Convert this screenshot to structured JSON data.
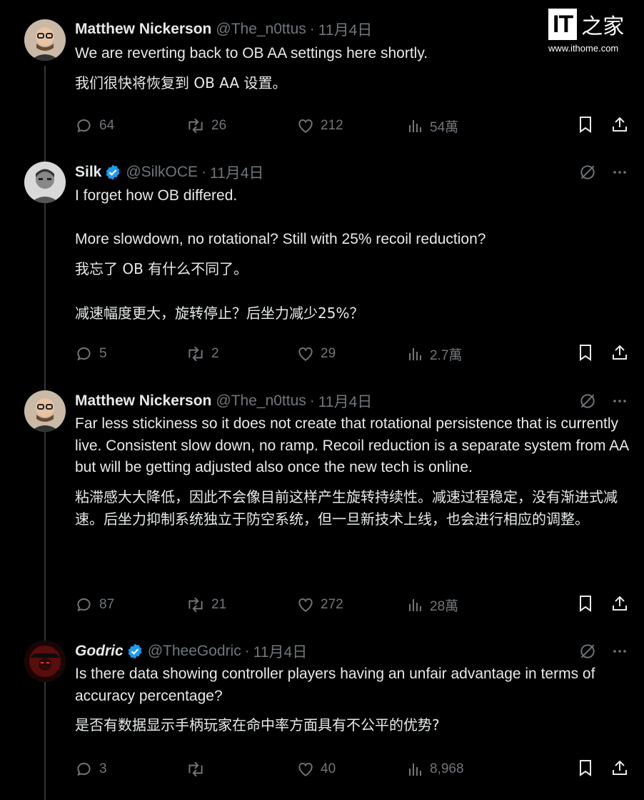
{
  "watermark": {
    "mark": "IT",
    "cn": "之家",
    "url": "www.ithome.com"
  },
  "tweets": [
    {
      "name": "Matthew Nickerson",
      "handle": "@The_n0ttus",
      "sep": "·",
      "date": "11月4日",
      "verified": false,
      "text_en": "We are reverting back to OB AA settings here shortly.",
      "text_zh": "我们很快将恢复到 OB AA 设置。",
      "replies": "64",
      "retweets": "26",
      "likes": "212",
      "views": "54萬"
    },
    {
      "name": "Silk",
      "handle": "@SilkOCE",
      "sep": "·",
      "date": "11月4日",
      "verified": true,
      "text_en": "I forget how OB differed.\n\nMore slowdown, no rotational? Still with 25% recoil reduction?",
      "text_zh": "我忘了 OB 有什么不同了。\n\n减速幅度更大，旋转停止？后坐力减少25%？",
      "replies": "5",
      "retweets": "2",
      "likes": "29",
      "views": "2.7萬"
    },
    {
      "name": "Matthew Nickerson",
      "handle": "@The_n0ttus",
      "sep": "·",
      "date": "11月4日",
      "verified": false,
      "text_en": "Far less stickiness so it does not create that rotational persistence that is currently live. Consistent slow down, no ramp. Recoil reduction is a separate system from AA but will be getting adjusted also once the new tech is online.",
      "text_zh": "粘滞感大大降低，因此不会像目前这样产生旋转持续性。减速过程稳定，没有渐进式减速。后坐力抑制系统独立于防空系统，但一旦新技术上线，也会进行相应的调整。",
      "replies": "87",
      "retweets": "21",
      "likes": "272",
      "views": "28萬"
    },
    {
      "name": "Godric",
      "handle": "@TheeGodric",
      "sep": "·",
      "date": "11月4日",
      "verified": true,
      "text_en": "Is there data showing controller players having an unfair advantage in terms of accuracy percentage?",
      "text_zh": "是否有数据显示手柄玩家在命中率方面具有不公平的优势?",
      "replies": "3",
      "retweets": "",
      "likes": "40",
      "views": "8,968"
    }
  ],
  "icons": {
    "reply": "reply-icon",
    "retweet": "retweet-icon",
    "like": "heart-icon",
    "views": "views-icon",
    "bookmark": "bookmark-icon",
    "share": "share-icon",
    "grok": "grok-icon",
    "more": "more-icon",
    "verified": "verified-badge-icon"
  },
  "colors": {
    "background": "#000000",
    "text": "#e7e9ea",
    "muted": "#71767b",
    "verified": "#1d9bf0"
  }
}
